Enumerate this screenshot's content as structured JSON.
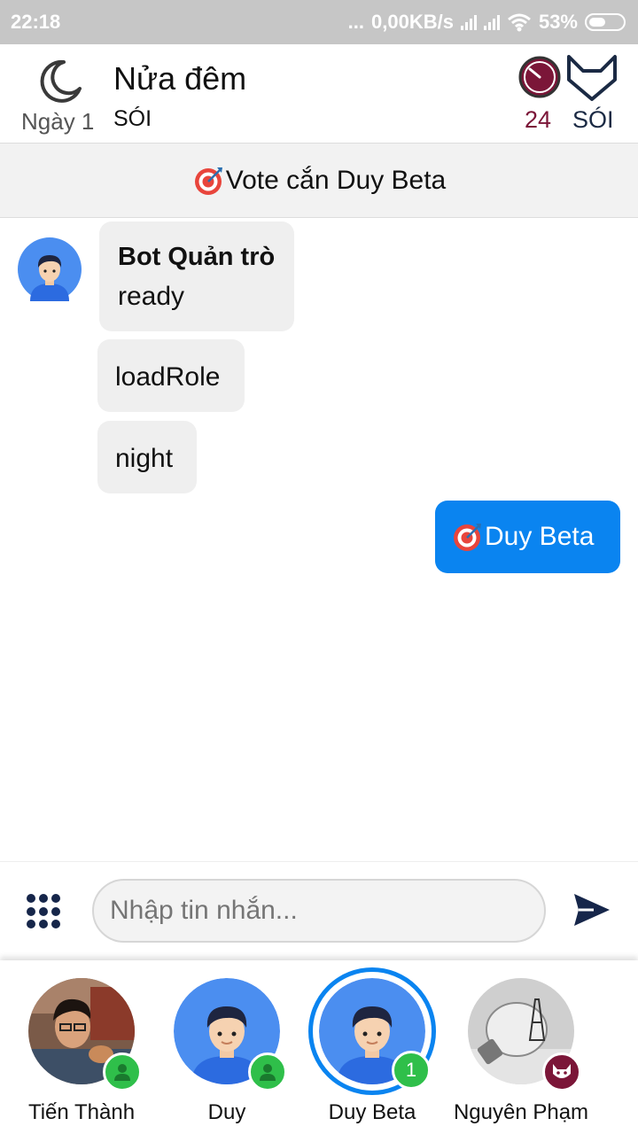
{
  "status_bar": {
    "time": "22:18",
    "dots": "...",
    "speed": "0,00KB/s",
    "battery": "53%"
  },
  "header": {
    "day_label": "Ngày 1",
    "phase_title": "Nửa đêm",
    "phase_subtitle": "SÓI",
    "timer_value": "24",
    "team_label": "SÓI",
    "icons": [
      "moon-icon",
      "timer-icon",
      "fox-icon"
    ]
  },
  "banner": {
    "text": "Vote cắn Duy Beta"
  },
  "messages": [
    {
      "sender": "Bot Quản trò",
      "text": "ready"
    },
    {
      "text": "loadRole"
    },
    {
      "text": "night"
    },
    {
      "text": "Duy Beta",
      "outgoing": true
    }
  ],
  "composer": {
    "placeholder": "Nhập tin nhắn..."
  },
  "players": [
    {
      "name": "Tiến Thành",
      "badge": "person"
    },
    {
      "name": "Duy",
      "badge": "person"
    },
    {
      "name": "Duy Beta",
      "badge": "1",
      "selected": true
    },
    {
      "name": "Nguyên Phạm",
      "badge": "wolf"
    }
  ],
  "colors": {
    "accent": "#0a84f0",
    "timer": "#7b1638",
    "badge_green": "#2fbf4a",
    "navy": "#16264a"
  }
}
